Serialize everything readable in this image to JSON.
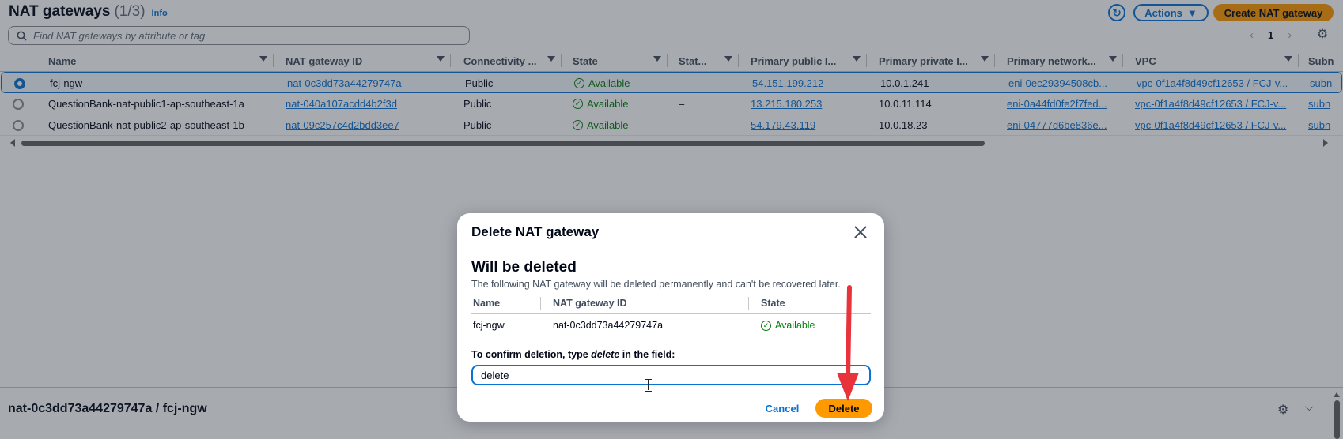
{
  "header": {
    "title": "NAT gateways",
    "count": "(1/3)",
    "info": "Info",
    "actions_label": "Actions",
    "create_label": "Create NAT gateway"
  },
  "search": {
    "placeholder": "Find NAT gateways by attribute or tag"
  },
  "pagination": {
    "page": "1"
  },
  "table": {
    "columns": [
      "Name",
      "NAT gateway ID",
      "Connectivity ...",
      "State",
      "Stat...",
      "Primary public I...",
      "Primary private I...",
      "Primary network...",
      "VPC",
      "Subn"
    ],
    "rows": [
      {
        "selected": true,
        "name": "fcj-ngw",
        "id": "nat-0c3dd73a44279747a",
        "connectivity": "Public",
        "state": "Available",
        "state_msg": "–",
        "public_ip": "54.151.199.212",
        "private_ip": "10.0.1.241",
        "eni": "eni-0ec29394508cb...",
        "vpc": "vpc-0f1a4f8d49cf12653 / FCJ-v...",
        "subnet": "subn"
      },
      {
        "selected": false,
        "name": "QuestionBank-nat-public1-ap-southeast-1a",
        "id": "nat-040a107acdd4b2f3d",
        "connectivity": "Public",
        "state": "Available",
        "state_msg": "–",
        "public_ip": "13.215.180.253",
        "private_ip": "10.0.11.114",
        "eni": "eni-0a44fd0fe2f7fed...",
        "vpc": "vpc-0f1a4f8d49cf12653 / FCJ-v...",
        "subnet": "subn"
      },
      {
        "selected": false,
        "name": "QuestionBank-nat-public2-ap-southeast-1b",
        "id": "nat-09c257c4d2bdd3ee7",
        "connectivity": "Public",
        "state": "Available",
        "state_msg": "–",
        "public_ip": "54.179.43.119",
        "private_ip": "10.0.18.23",
        "eni": "eni-04777d6be836e...",
        "vpc": "vpc-0f1a4f8d49cf12653 / FCJ-v...",
        "subnet": "subn"
      }
    ]
  },
  "split_panel": {
    "title": "nat-0c3dd73a44279747a / fcj-ngw"
  },
  "modal": {
    "title": "Delete NAT gateway",
    "heading": "Will be deleted",
    "description": "The following NAT gateway will be deleted permanently and can't be recovered later.",
    "columns": [
      "Name",
      "NAT gateway ID",
      "State"
    ],
    "row": {
      "name": "fcj-ngw",
      "id": "nat-0c3dd73a44279747a",
      "state": "Available"
    },
    "confirm_prefix": "To confirm deletion, type ",
    "confirm_word": "delete",
    "confirm_suffix": " in the field:",
    "input_value": "delete",
    "cancel_label": "Cancel",
    "delete_label": "Delete"
  },
  "colors": {
    "accent": "#0972d3",
    "primary_button": "#ff9900",
    "success": "#037f0c",
    "annotation_arrow": "#e8333b"
  }
}
